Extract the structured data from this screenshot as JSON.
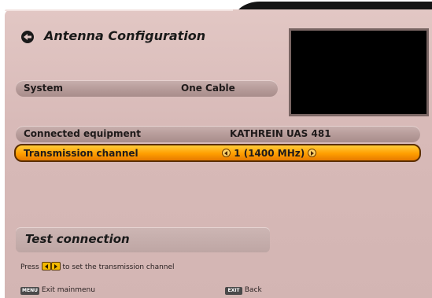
{
  "title": "Antenna Configuration",
  "rows": [
    {
      "label": "System",
      "value": "One Cable"
    },
    {
      "label": "Connected equipment",
      "value": "KATHREIN UAS 481"
    },
    {
      "label": "Transmission channel",
      "value": "1 (1400 MHz)"
    }
  ],
  "test_button": "Test connection",
  "hint": {
    "before": "Press",
    "after": "to set the transmission channel"
  },
  "footer": {
    "menu_key": "MENU",
    "menu_label": "Exit mainmenu",
    "exit_key": "EXIT",
    "exit_label": "Back"
  },
  "colors": {
    "panel": "#d8bab8",
    "selected": "#ff9e00",
    "preview": "#000000"
  }
}
